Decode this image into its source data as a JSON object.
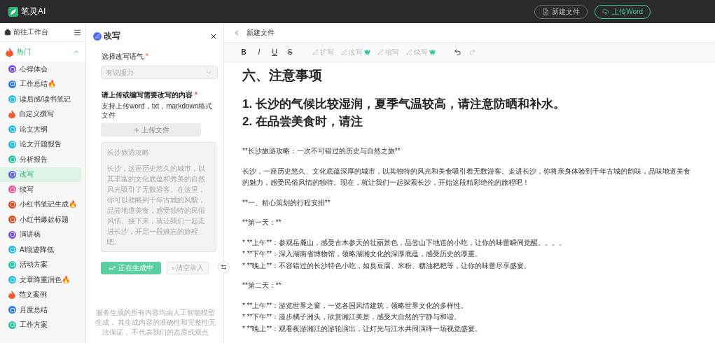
{
  "app": {
    "logo_text": "笔灵AI",
    "buttons": [
      {
        "label": "新建文件",
        "kind": "new"
      },
      {
        "label": "上传Word",
        "kind": "upload"
      }
    ]
  },
  "sidebar": {
    "home": "前往工作台",
    "section": {
      "label": "热门",
      "expanded": true
    },
    "items": [
      {
        "label": "心得体会",
        "kind": "circle",
        "color": "#7b4ce8",
        "selected": false
      },
      {
        "label": "工作总结🔥",
        "kind": "circle",
        "color": "#2f7bf0",
        "selected": false
      },
      {
        "label": "读后感/读书笔记",
        "kind": "circle",
        "color": "#1fc0e8",
        "selected": false
      },
      {
        "label": "自定义撰写",
        "kind": "flame",
        "color": "#f5592c",
        "selected": false
      },
      {
        "label": "论文大纲",
        "kind": "circle",
        "color": "#1fc0e8",
        "selected": false
      },
      {
        "label": "论文开题报告",
        "kind": "circle",
        "color": "#1fc0e8",
        "selected": false
      },
      {
        "label": "分析报告",
        "kind": "circle",
        "color": "#26c6a6",
        "selected": false
      },
      {
        "label": "改写",
        "kind": "circle",
        "color": "#5a62f0",
        "selected": true
      },
      {
        "label": "续写",
        "kind": "circle",
        "color": "#f4539b",
        "selected": false
      },
      {
        "label": "小红书笔记生成🔥",
        "kind": "circle",
        "color": "#e84a1b",
        "selected": false
      },
      {
        "label": "小红书爆款标题",
        "kind": "circle",
        "color": "#e84a1b",
        "selected": false
      },
      {
        "label": "演讲稿",
        "kind": "circle",
        "color": "#7b4ce8",
        "selected": false
      },
      {
        "label": "AI痕迹降低",
        "kind": "circle",
        "color": "#1fc0e8",
        "selected": false
      },
      {
        "label": "活动方案",
        "kind": "circle",
        "color": "#26c6a6",
        "selected": false
      },
      {
        "label": "文章降重润色🔥",
        "kind": "circle",
        "color": "#1fc0e8",
        "selected": false
      },
      {
        "label": "范文案例",
        "kind": "flame",
        "color": "#f5592c",
        "selected": false
      },
      {
        "label": "月度总结",
        "kind": "circle",
        "color": "#2f7bf0",
        "selected": false
      },
      {
        "label": "工作方案",
        "kind": "circle",
        "color": "#26c6a6",
        "selected": false
      }
    ]
  },
  "panel": {
    "title": "改写",
    "fields": [
      {
        "label": "选择改写语气",
        "required": true
      },
      {
        "label": "请上传或编写需要改写的内容",
        "required": true
      }
    ],
    "tone_value": "有说服力",
    "upload_hint": "支持上传word，txt，markdown格式文件",
    "upload_button": "上传文件",
    "required_mark": "*",
    "content_title": "长沙旅游攻略",
    "content_body": "长沙，这座历史悠久的城市，以其丰富的文化底蕴和秀美的自然风光吸引了无数游客。在这里，你可以领略到千年古城的风貌，品尝地道美食，感受独特的民俗风情。接下来，就让我们一起走进长沙，开启一段难忘的旅程吧。",
    "generate_button": {
      "label": "正在生成中",
      "loading": true
    },
    "clear_button": {
      "label": "清空录入",
      "disabled": true
    },
    "disclaimer": "服务生成的所有内容均由人工智能模型生成， 其生成内容的准确性和完整性无法保证， 不代表我们的态度或观点"
  },
  "editor": {
    "title": "新建文件",
    "format_tools": [
      {
        "label": "B",
        "kind": "bold"
      },
      {
        "label": "I",
        "kind": "italic"
      },
      {
        "label": "U",
        "kind": "underline"
      },
      {
        "label": "S",
        "kind": "strike"
      }
    ],
    "ai_tools": [
      {
        "label": "扩写",
        "premium": false,
        "disabled": true
      },
      {
        "label": "改写",
        "premium": true,
        "disabled": true
      },
      {
        "label": "缩写",
        "premium": false,
        "disabled": true
      },
      {
        "label": "续写",
        "premium": true,
        "disabled": true
      }
    ],
    "history": [
      {
        "kind": "undo",
        "disabled": false
      },
      {
        "kind": "redo",
        "disabled": true
      }
    ],
    "heading": "六、注意事项",
    "big_lines": [
      "1. 长沙的气候比较湿润，夏季气温较高，请注意防晒和补水。",
      "2. 在品尝美食时，请注"
    ],
    "blocks": [
      {
        "lines": [
          "**长沙旅游攻略：一次不可错过的历史与自然之旅**"
        ]
      },
      {
        "lines": [
          "长沙，一座历史悠久、文化底蕴深厚的城市，以其独特的风光和美食吸引着无数游客。走进长沙，你将亲身体验到千年古城的韵味，品味地道美食的魅力，感受民俗风情的独特。现在，就让我们一起探索长沙，开始这段精彩绝伦的旅程吧！"
        ]
      },
      {
        "lines": [
          "**一、精心策划的行程安排**"
        ]
      },
      {
        "lines": [
          "**第一天：**"
        ]
      },
      {
        "lines": [
          "* **上午**：参观岳麓山，感受古木参天的壮丽景色，品尝山下地道的小吃，让你的味蕾瞬间觉醒。。。。",
          "* **下午**：深入湖南省博物馆，领略湖湘文化的深厚底蕴，感受历史的厚重。",
          "* **晚上**：不容错过的长沙特色小吃，如臭豆腐、米粉、糖油粑粑等，让你的味蕾尽享盛宴。"
        ]
      },
      {
        "lines": [
          "**第二天：**"
        ]
      },
      {
        "lines": [
          "* **上午**：游览世界之窗，一览各国风情建筑，领略世界文化的多样性。",
          "* **下午**：漫步橘子洲头，欣赏湘江美景，感受大自然的宁静与和谐。",
          "* **晚上**：观看夜游湘江的游轮演出，让灯光与江水共同演绎一场视觉盛宴。"
        ]
      }
    ]
  }
}
